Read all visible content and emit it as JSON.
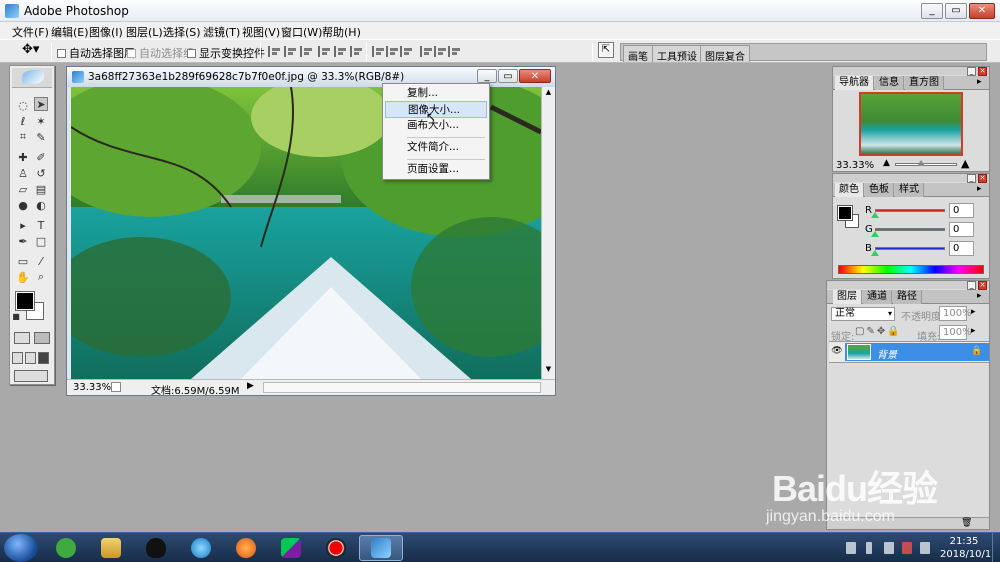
{
  "app": {
    "title": "Adobe Photoshop"
  },
  "window_controls": {
    "minimize": "_",
    "restore": "▭",
    "close": "✕"
  },
  "menubar": [
    "文件(F)",
    "编辑(E)",
    "图像(I)",
    "图层(L)",
    "选择(S)",
    "滤镜(T)",
    "视图(V)",
    "窗口(W)",
    "帮助(H)"
  ],
  "options": {
    "auto_select_layer": "自动选择图层",
    "auto_select_group": "自动选择组",
    "show_transform": "显示变换控件",
    "well_tabs": [
      "画笔",
      "工具预设",
      "图层复合"
    ]
  },
  "document": {
    "title": "3a68ff27363e1b289f69628c7b7f0e0f.jpg @ 33.3%(RGB/8#)",
    "zoom": "33.33%",
    "status": "文档:6.59M/6.59M"
  },
  "context_menu": {
    "items": [
      "复制...",
      "图像大小...",
      "画布大小...",
      "文件简介...",
      "页面设置..."
    ],
    "hover_index": 1
  },
  "navigator_panel": {
    "tabs": [
      "导航器",
      "信息",
      "直方图"
    ],
    "zoom": "33.33%"
  },
  "color_panel": {
    "tabs": [
      "颜色",
      "色板",
      "样式"
    ],
    "channels": [
      {
        "label": "R",
        "value": "0",
        "color": "#d81e1e"
      },
      {
        "label": "G",
        "value": "0",
        "color": "#1e9a2a"
      },
      {
        "label": "B",
        "value": "0",
        "color": "#1e2ecc"
      }
    ]
  },
  "layers_panel": {
    "tabs": [
      "图层",
      "通道",
      "路径"
    ],
    "blend_mode": "正常",
    "opacity_label": "不透明度:",
    "opacity_value": "100%",
    "lock_label": "锁定:",
    "fill_label": "填充:",
    "fill_value": "100%",
    "layers": [
      {
        "name": "背景",
        "selected": true
      }
    ]
  },
  "taskbar": {
    "time": "21:35",
    "date": "2018/10/1"
  },
  "watermark": {
    "brand": "Baidu经验",
    "url": "jingyan.baidu.com"
  },
  "colors": {
    "desktop_bg": "#a9a9a9",
    "selection": "#3d8ee6",
    "taskbar": "#1d3557"
  }
}
